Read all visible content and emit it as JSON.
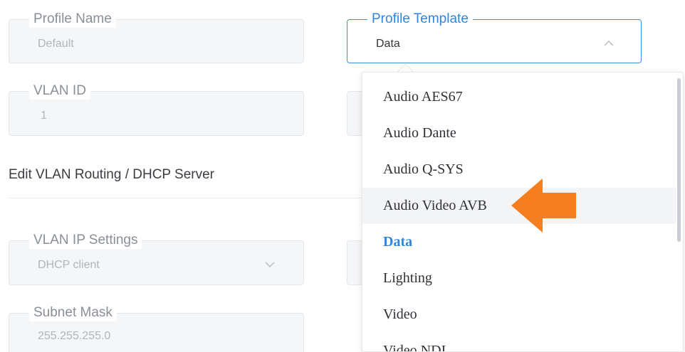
{
  "form": {
    "profile_name": {
      "label": "Profile Name",
      "value": "Default"
    },
    "profile_template": {
      "label": "Profile Template",
      "value": "Data"
    },
    "vlan_id": {
      "label": "VLAN ID",
      "value": "1"
    },
    "section_title": "Edit VLAN Routing / DHCP Server",
    "vlan_ip_settings": {
      "label": "VLAN IP Settings",
      "value": "DHCP client"
    },
    "subnet_mask": {
      "label": "Subnet Mask",
      "value": "255.255.255.0"
    }
  },
  "dropdown": {
    "options": [
      {
        "label": "Audio AES67"
      },
      {
        "label": "Audio Dante"
      },
      {
        "label": "Audio Q-SYS"
      },
      {
        "label": "Audio Video AVB",
        "highlighted": true
      },
      {
        "label": "Data",
        "selected": true
      },
      {
        "label": "Lighting"
      },
      {
        "label": "Video"
      },
      {
        "label": "Video NDI"
      }
    ]
  },
  "colors": {
    "accent_blue": "#2f86dc",
    "annotation_arrow": "#f47e20",
    "field_background": "#f5f6f8"
  },
  "icons": {
    "chevron_up": "chevron-up-icon",
    "chevron_down": "chevron-down-icon",
    "annotation_arrow": "left-arrow-annotation"
  }
}
